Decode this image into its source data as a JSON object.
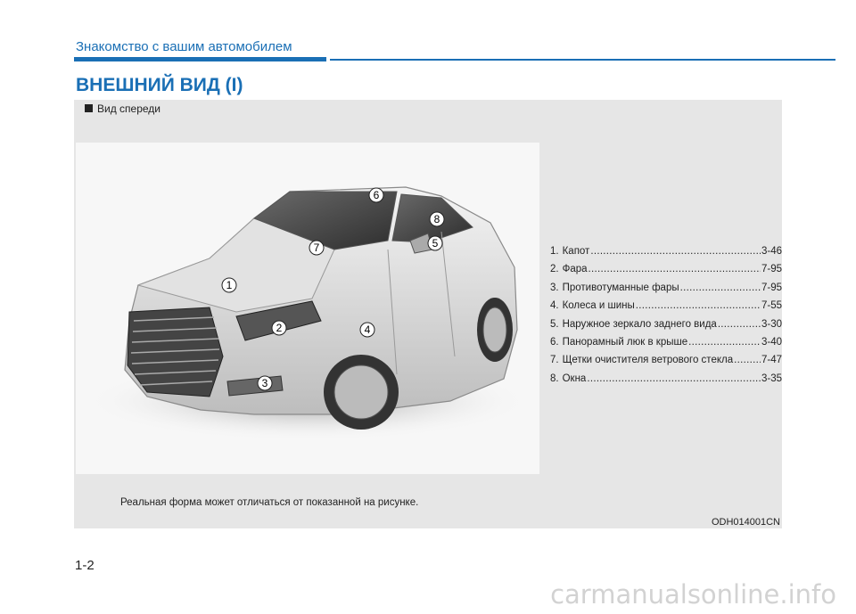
{
  "header": {
    "chapter": "Знакомство с вашим автомобилем",
    "title": "ВНЕШНИЙ ВИД (I)"
  },
  "panel": {
    "section": "Вид спереди",
    "parts": [
      {
        "num": "1.",
        "name": "Капот",
        "page": "3-46"
      },
      {
        "num": "2.",
        "name": "Фара",
        "page": "7-95"
      },
      {
        "num": "3.",
        "name": "Противотуманные фары",
        "page": "7-95"
      },
      {
        "num": "4.",
        "name": "Колеса и шины",
        "page": "7-55"
      },
      {
        "num": "5.",
        "name": "Наружное зеркало заднего вида",
        "page": "3-30"
      },
      {
        "num": "6.",
        "name": "Панорамный люк в крыше",
        "page": "3-40"
      },
      {
        "num": "7.",
        "name": "Щетки очистителя ветрового стекла",
        "page": "7-47"
      },
      {
        "num": "8.",
        "name": "Окна",
        "page": "3-35"
      }
    ],
    "callouts": [
      "1",
      "2",
      "3",
      "4",
      "5",
      "6",
      "7",
      "8"
    ],
    "note": "Реальная форма может отличаться от показанной на рисунке.",
    "figure_code": "ODH014001CN"
  },
  "footer": {
    "page_number": "1-2",
    "watermark": "carmanualsonline.info"
  }
}
